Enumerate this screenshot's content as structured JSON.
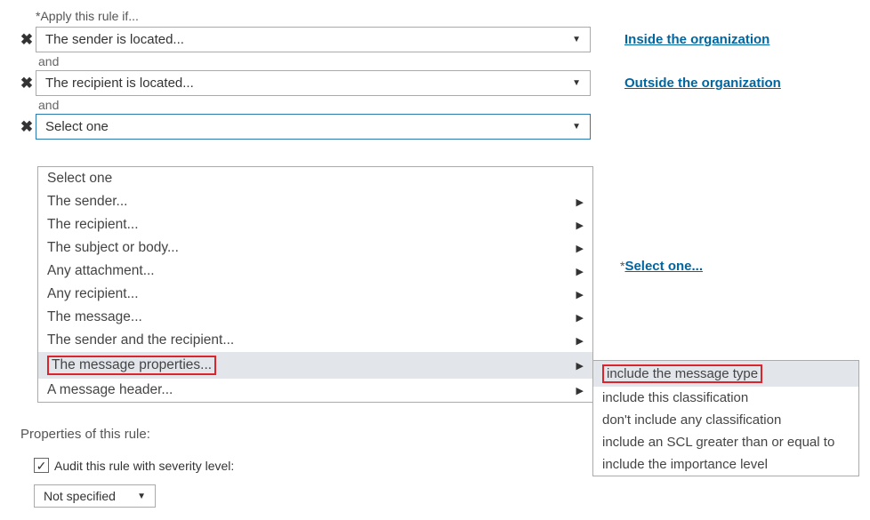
{
  "header": "*Apply this rule if...",
  "conditions": [
    {
      "text": "The sender is located...",
      "link": "Inside the organization"
    },
    {
      "text": "The recipient is located...",
      "link": "Outside the organization"
    }
  ],
  "and": "and",
  "third_dropdown": "Select one",
  "select_one_asterisk": "*",
  "select_one_text": "Select one...",
  "options": {
    "select_one": "Select one",
    "sender": "The sender...",
    "recipient": "The recipient...",
    "subject_body": "The subject or body...",
    "attachment": "Any attachment...",
    "any_recipient": "Any recipient...",
    "message": "The message...",
    "sender_recipient": "The sender and the recipient...",
    "msg_properties": "The message properties...",
    "msg_header": "A message header..."
  },
  "submenu": {
    "msg_type": "include the message type",
    "classification": "include this classification",
    "no_classification": "don't include any classification",
    "scl": "include an SCL greater than or equal to",
    "importance": "include the importance level"
  },
  "properties_label": "Properties of this rule:",
  "audit_label": "Audit this rule with severity level:",
  "severity_value": "Not specified"
}
